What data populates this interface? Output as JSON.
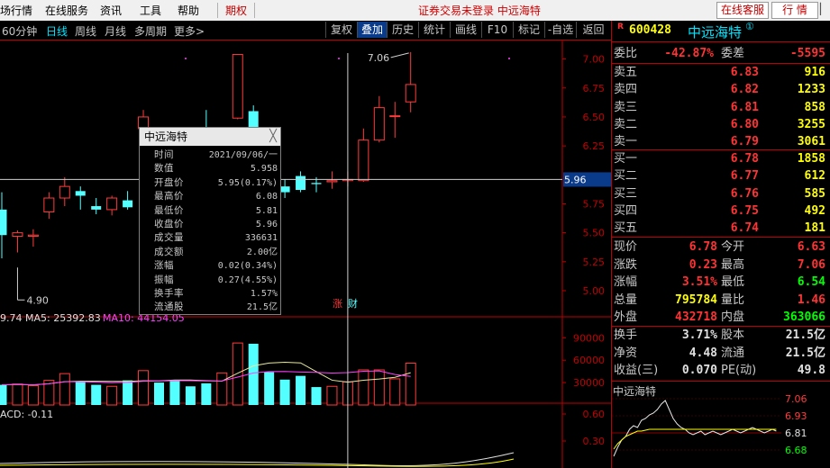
{
  "menu": {
    "items": [
      "场行情",
      "在线服务",
      "资讯",
      "工具",
      "帮助"
    ],
    "qiquan": "期权",
    "notice": "证券交易未登录  中远海特",
    "online_service": "在线客服",
    "market": "行  情"
  },
  "toolbar": {
    "left": [
      "60分钟",
      "日线",
      "周线",
      "月线",
      "多周期",
      "更多>"
    ],
    "active_left": "日线",
    "right": [
      "复权",
      "叠加",
      "历史",
      "统计",
      "画线",
      "F10",
      "标记",
      "-自选",
      "返回"
    ],
    "active_right": "叠加"
  },
  "chart_data": {
    "type": "candlestick",
    "price_axis_ticks": [
      7.0,
      6.75,
      6.5,
      6.25,
      5.75,
      5.5,
      5.25,
      5.0
    ],
    "price_range": [
      4.79,
      7.16
    ],
    "cursor_price_label": "5.96",
    "high_annotation": "7.06",
    "low_annotation": "4.90",
    "markers": [
      "涨",
      "财"
    ],
    "candles": [
      {
        "o": 5.7,
        "h": 5.85,
        "l": 5.28,
        "c": 5.48
      },
      {
        "o": 5.47,
        "h": 5.52,
        "l": 5.33,
        "c": 5.5
      },
      {
        "o": 5.47,
        "h": 5.53,
        "l": 5.38,
        "c": 5.48
      },
      {
        "o": 5.68,
        "h": 5.85,
        "l": 5.62,
        "c": 5.8
      },
      {
        "o": 5.8,
        "h": 5.98,
        "l": 5.73,
        "c": 5.9
      },
      {
        "o": 5.86,
        "h": 5.9,
        "l": 5.7,
        "c": 5.82
      },
      {
        "o": 5.73,
        "h": 5.8,
        "l": 5.66,
        "c": 5.7
      },
      {
        "o": 5.7,
        "h": 5.82,
        "l": 5.65,
        "c": 5.8
      },
      {
        "o": 5.78,
        "h": 5.86,
        "l": 5.7,
        "c": 5.72
      },
      {
        "o": 6.4,
        "h": 6.56,
        "l": 6.3,
        "c": 6.5
      },
      {
        "o": 6.2,
        "h": 6.3,
        "l": 5.98,
        "c": 6.05
      },
      {
        "o": 6.1,
        "h": 6.2,
        "l": 5.95,
        "c": 5.99
      },
      {
        "o": 6.15,
        "h": 6.3,
        "l": 6.0,
        "c": 6.06
      },
      {
        "o": 6.4,
        "h": 6.56,
        "l": 6.2,
        "c": 6.3
      },
      {
        "o": 6.0,
        "h": 6.4,
        "l": 5.92,
        "c": 6.32
      },
      {
        "o": 6.49,
        "h": 7.04,
        "l": 6.48,
        "c": 7.04
      },
      {
        "o": 6.55,
        "h": 6.6,
        "l": 6.4,
        "c": 6.4
      },
      {
        "o": 6.05,
        "h": 6.1,
        "l": 5.85,
        "c": 5.99
      },
      {
        "o": 5.9,
        "h": 5.96,
        "l": 5.8,
        "c": 5.85
      },
      {
        "o": 5.99,
        "h": 6.03,
        "l": 5.85,
        "c": 5.87
      },
      {
        "o": 5.93,
        "h": 5.98,
        "l": 5.85,
        "c": 5.92
      },
      {
        "o": 5.94,
        "h": 6.03,
        "l": 5.88,
        "c": 5.95
      },
      {
        "o": 5.95,
        "h": 6.03,
        "l": 5.9,
        "c": 5.96
      },
      {
        "o": 5.95,
        "h": 6.4,
        "l": 5.94,
        "c": 6.3
      },
      {
        "o": 6.3,
        "h": 6.68,
        "l": 6.28,
        "c": 6.58
      },
      {
        "o": 6.51,
        "h": 6.63,
        "l": 6.32,
        "c": 6.51
      },
      {
        "o": 6.63,
        "h": 7.06,
        "l": 6.54,
        "c": 6.78
      }
    ],
    "volume": {
      "label_prefix": "9.74",
      "ma5_label": "MA5: 25392.83",
      "ma10_label": "MA10: 44154.05",
      "axis_ticks": [
        90000,
        60000,
        30000
      ],
      "max": 100000,
      "values": [
        27000,
        28000,
        26000,
        33000,
        42000,
        31000,
        27000,
        25000,
        33000,
        46000,
        30000,
        33000,
        25000,
        29000,
        43000,
        83000,
        82000,
        44000,
        34000,
        39000,
        24000,
        25000,
        31000,
        47000,
        47000,
        35000,
        56000
      ]
    },
    "macd": {
      "label": "ACD: -0.11",
      "axis_ticks": [
        0.6,
        0.3
      ]
    }
  },
  "popup": {
    "title": "中远海特",
    "rows": [
      {
        "k": "时间",
        "v": "2021/09/06/一",
        "c": "wht"
      },
      {
        "k": "数值",
        "v": "5.958",
        "c": "wht"
      },
      {
        "k": "开盘价",
        "v": "5.95(0.17%)",
        "c": "red"
      },
      {
        "k": "最高价",
        "v": "6.08",
        "c": "red"
      },
      {
        "k": "最低价",
        "v": "5.81",
        "c": "grn"
      },
      {
        "k": "收盘价",
        "v": "5.96",
        "c": "red"
      },
      {
        "k": "成交量",
        "v": "336631",
        "c": "yel"
      },
      {
        "k": "成交额",
        "v": "2.00亿",
        "c": "wht"
      },
      {
        "k": "涨幅",
        "v": "0.02(0.34%)",
        "c": "red"
      },
      {
        "k": "振幅",
        "v": "0.27(4.55%)",
        "c": "wht"
      },
      {
        "k": "换手率",
        "v": "1.57%",
        "c": "wht"
      },
      {
        "k": "流通股",
        "v": "21.5亿",
        "c": "wht"
      }
    ]
  },
  "quote": {
    "r_badge": "R",
    "code": "600428",
    "name": "中远海特",
    "superscript": "①",
    "weibi_label": "委比",
    "weibi_value": "-42.87%",
    "weicha_label": "委差",
    "weicha_value": "-5595",
    "asks": [
      {
        "k": "卖五",
        "p": "6.83",
        "q": "916"
      },
      {
        "k": "卖四",
        "p": "6.82",
        "q": "1233"
      },
      {
        "k": "卖三",
        "p": "6.81",
        "q": "858"
      },
      {
        "k": "卖二",
        "p": "6.80",
        "q": "3255"
      },
      {
        "k": "卖一",
        "p": "6.79",
        "q": "3061"
      }
    ],
    "bids": [
      {
        "k": "买一",
        "p": "6.78",
        "q": "1858"
      },
      {
        "k": "买二",
        "p": "6.77",
        "q": "612"
      },
      {
        "k": "买三",
        "p": "6.76",
        "q": "585"
      },
      {
        "k": "买四",
        "p": "6.75",
        "q": "492"
      },
      {
        "k": "买五",
        "p": "6.74",
        "q": "181"
      }
    ],
    "stats": [
      {
        "k1": "现价",
        "v1": "6.78",
        "c1": "red",
        "k2": "今开",
        "v2": "6.63",
        "c2": "red"
      },
      {
        "k1": "涨跌",
        "v1": "0.23",
        "c1": "red",
        "k2": "最高",
        "v2": "7.06",
        "c2": "red"
      },
      {
        "k1": "涨幅",
        "v1": "3.51%",
        "c1": "red",
        "k2": "最低",
        "v2": "6.54",
        "c2": "grn"
      },
      {
        "k1": "总量",
        "v1": "795784",
        "c1": "yel",
        "k2": "量比",
        "v2": "1.46",
        "c2": "red"
      },
      {
        "k1": "外盘",
        "v1": "432718",
        "c1": "red",
        "k2": "内盘",
        "v2": "363066",
        "c2": "grn"
      }
    ],
    "stats2": [
      {
        "k1": "换手",
        "v1": "3.71%",
        "c1": "wht",
        "k2": "股本",
        "v2": "21.5亿",
        "c2": "wht"
      },
      {
        "k1": "净资",
        "v1": "4.48",
        "c1": "wht",
        "k2": "流通",
        "v2": "21.5亿",
        "c2": "wht"
      },
      {
        "k1": "收益(三)",
        "v1": "0.070",
        "c1": "wht",
        "k2": "PE(动)",
        "v2": "49.8",
        "c2": "wht"
      }
    ],
    "mini_chart": {
      "title": "中远海特",
      "ticks": [
        "7.06",
        "6.93",
        "6.81",
        "6.68"
      ]
    }
  }
}
